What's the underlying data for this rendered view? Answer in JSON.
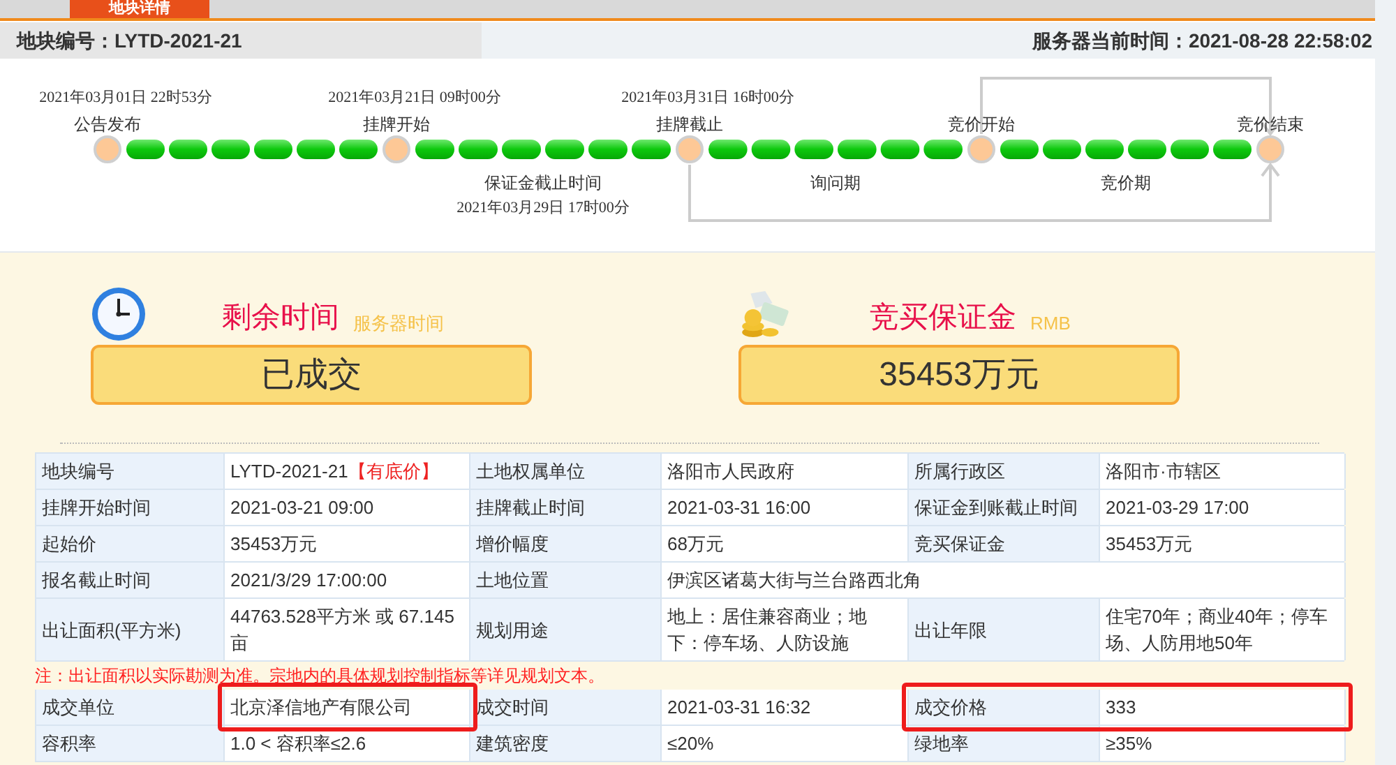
{
  "top_tab": {
    "label": "地块详情"
  },
  "header": {
    "parcel": "地块编号：LYTD-2021-21",
    "server_time": "服务器当前时间：2021-08-28 22:58:02"
  },
  "timeline": {
    "nodes": [
      {
        "time": "2021年03月01日 22时53分",
        "label": "公告发布"
      },
      {
        "time": "2021年03月21日 09时00分",
        "label": "挂牌开始",
        "next_segment": {
          "label": "保证金截止时间",
          "time": "2021年03月29日 17时00分"
        }
      },
      {
        "time": "2021年03月31日 16时00分",
        "label": "挂牌截止",
        "next_segment": {
          "label": "询问期"
        }
      },
      {
        "label": "竞价开始",
        "next_segment": {
          "label": "竞价期"
        }
      },
      {
        "label": "竞价结束"
      }
    ]
  },
  "summary": [
    {
      "kind": "clock",
      "title": "剩余时间",
      "subtitle": "服务器时间",
      "value": "已成交"
    },
    {
      "kind": "money",
      "title": "竞买保证金",
      "subtitle": "RMB",
      "value": "35453万元"
    }
  ],
  "table": [
    {
      "kind": "fields",
      "cells": [
        {
          "text": "地块编号"
        },
        {
          "text": "LYTD-2021-21",
          "tag": "【有底价】"
        },
        {
          "text": "土地权属单位"
        },
        {
          "text": "洛阳市人民政府"
        },
        {
          "text": "所属行政区"
        },
        {
          "text": "洛阳市·市辖区"
        }
      ]
    },
    {
      "kind": "fields",
      "cells": [
        {
          "text": "挂牌开始时间"
        },
        {
          "text": "2021-03-21 09:00"
        },
        {
          "text": "挂牌截止时间"
        },
        {
          "text": "2021-03-31 16:00"
        },
        {
          "text": "保证金到账截止时间"
        },
        {
          "text": "2021-03-29 17:00"
        }
      ]
    },
    {
      "kind": "fields",
      "cells": [
        {
          "text": "起始价"
        },
        {
          "text": "35453万元"
        },
        {
          "text": "增价幅度"
        },
        {
          "text": "68万元"
        },
        {
          "text": "竞买保证金"
        },
        {
          "text": "35453万元"
        }
      ]
    },
    {
      "kind": "fields",
      "cells": [
        {
          "text": "报名截止时间"
        },
        {
          "text": "2021/3/29 17:00:00"
        },
        {
          "text": "土地位置"
        },
        {
          "text": "伊滨区诸葛大街与兰台路西北角"
        }
      ]
    },
    {
      "kind": "fields",
      "cells": [
        {
          "text": "出让面积(平方米)"
        },
        {
          "text": "44763.528平方米 或  67.145亩"
        },
        {
          "text": "规划用途"
        },
        {
          "text": "地上：居住兼容商业；地下：停车场、人防设施"
        },
        {
          "text": "出让年限"
        },
        {
          "text": "住宅70年；商业40年；停车场、人防用地50年"
        }
      ]
    },
    {
      "kind": "note",
      "text": "注：出让面积以实际勘测为准。宗地内的具体规划控制指标等详见规划文本。"
    },
    {
      "kind": "fields",
      "cells": [
        {
          "text": "成交单位"
        },
        {
          "text": "北京泽信地产有限公司",
          "highlighted": true
        },
        {
          "text": "成交时间"
        },
        {
          "text": "2021-03-31 16:32"
        },
        {
          "text": "成交价格",
          "highlighted": true
        },
        {
          "text": "333",
          "highlighted": true
        }
      ]
    },
    {
      "kind": "fields",
      "cells": [
        {
          "text": "容积率"
        },
        {
          "text": "1.0 < 容积率≤2.6"
        },
        {
          "text": "建筑密度"
        },
        {
          "text": "≤20%"
        },
        {
          "text": "绿地率"
        },
        {
          "text": "≥35%"
        }
      ]
    }
  ]
}
